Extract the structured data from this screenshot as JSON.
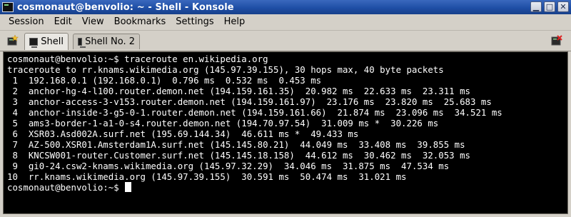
{
  "window": {
    "title": "cosmonaut@benvolio: ~ - Shell - Konsole",
    "controls": {
      "minimize": "▁",
      "maximize": "□",
      "close": "✕"
    }
  },
  "menubar": {
    "items": [
      "Session",
      "Edit",
      "View",
      "Bookmarks",
      "Settings",
      "Help"
    ]
  },
  "tabs": [
    {
      "label": "Shell",
      "active": true
    },
    {
      "label": "Shell No. 2",
      "active": false
    }
  ],
  "terminal": {
    "lines": [
      "cosmonaut@benvolio:~$ traceroute en.wikipedia.org",
      "traceroute to rr.knams.wikimedia.org (145.97.39.155), 30 hops max, 40 byte packets",
      " 1  192.168.0.1 (192.168.0.1)  0.796 ms  0.532 ms  0.453 ms",
      " 2  anchor-hg-4-l100.router.demon.net (194.159.161.35)  20.982 ms  22.633 ms  23.311 ms",
      " 3  anchor-access-3-v153.router.demon.net (194.159.161.97)  23.176 ms  23.820 ms  25.683 ms",
      " 4  anchor-inside-3-g5-0-1.router.demon.net (194.159.161.66)  21.874 ms  23.096 ms  34.521 ms",
      " 5  ams3-border-1-a1-0-s4.router.demon.net (194.70.97.54)  31.009 ms *  30.226 ms",
      " 6  XSR03.Asd002A.surf.net (195.69.144.34)  46.611 ms *  49.433 ms",
      " 7  AZ-500.XSR01.Amsterdam1A.surf.net (145.145.80.21)  44.049 ms  33.408 ms  39.855 ms",
      " 8  KNCSW001-router.Customer.surf.net (145.145.18.158)  44.612 ms  30.462 ms  32.053 ms",
      " 9  gi0-24.csw2-knams.wikimedia.org (145.97.32.29)  34.046 ms  31.875 ms  47.534 ms",
      "10  rr.knams.wikimedia.org (145.97.39.155)  30.591 ms  50.474 ms  31.021 ms"
    ],
    "prompt": "cosmonaut@benvolio:~$ "
  },
  "colors": {
    "titlebar": "#1f4fa6",
    "terminal_bg": "#000000",
    "terminal_fg": "#ffffff"
  }
}
